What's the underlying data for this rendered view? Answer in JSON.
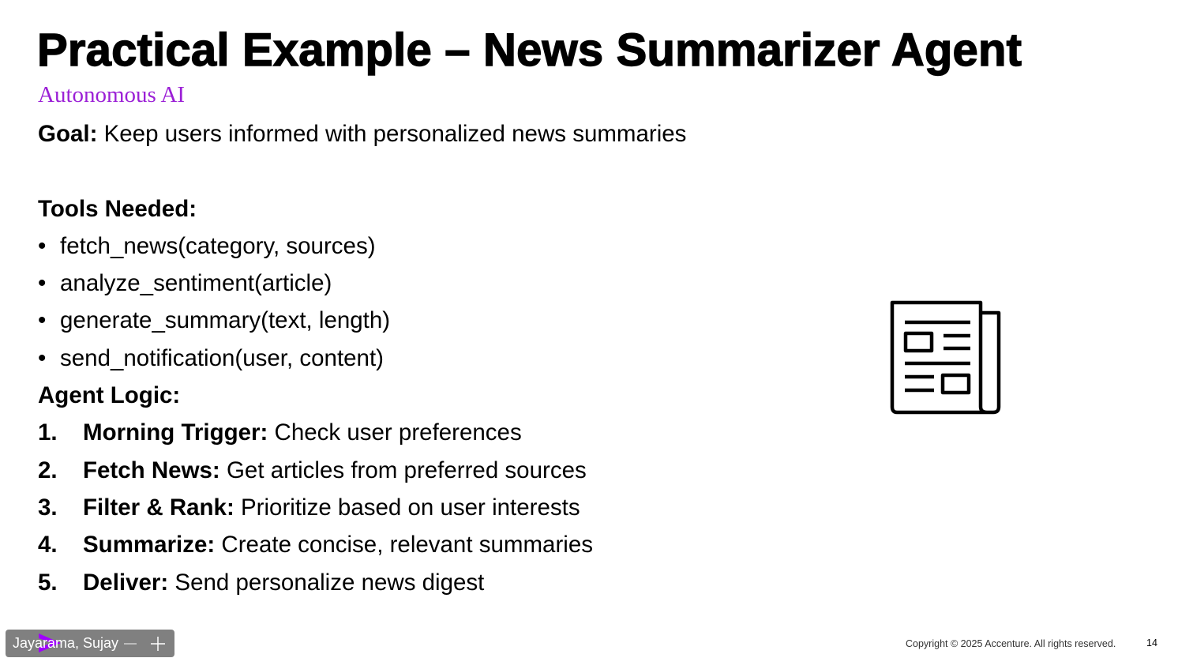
{
  "slide": {
    "title": "Practical Example – News Summarizer Agent",
    "subtitle": "Autonomous AI",
    "goal": {
      "label": "Goal:",
      "text": " Keep users informed with personalized news summaries"
    },
    "tools": {
      "heading": "Tools Needed:",
      "bullet": "•",
      "items": [
        "fetch_news(category, sources)",
        "analyze_sentiment(article)",
        "generate_summary(text, length)",
        "send_notification(user, content)"
      ]
    },
    "logic": {
      "heading": "Agent Logic:",
      "steps": [
        {
          "num": "1.",
          "label": "Morning Trigger:",
          "text": " Check user preferences"
        },
        {
          "num": "2.",
          "label": "Fetch News:",
          "text": " Get articles from preferred sources"
        },
        {
          "num": "3.",
          "label": "Filter & Rank:",
          "text": " Prioritize based on user interests"
        },
        {
          "num": "4.",
          "label": "Summarize:",
          "text": " Create concise, relevant summaries"
        },
        {
          "num": "5.",
          "label": "Deliver:",
          "text": " Send personalize news digest"
        }
      ]
    },
    "icon": "newspaper-icon",
    "colors": {
      "subtitle": "#9b1fd6",
      "brand_logo": "#a100ff"
    }
  },
  "footer": {
    "copyright": "Copyright © 2025 Accenture. All rights reserved.",
    "page_number": "14"
  },
  "presenter_chip": {
    "name": "Jayarama, Sujay",
    "logo_icon": "accenture-chevron-icon",
    "minus_icon": "minus-icon",
    "plus_icon": "plus-icon"
  }
}
